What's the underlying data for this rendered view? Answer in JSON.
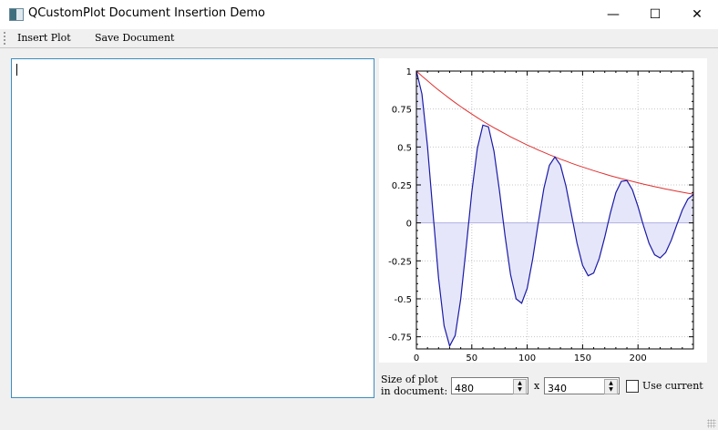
{
  "window": {
    "title": "QCustomPlot Document Insertion Demo",
    "minimize": "—",
    "maximize": "☐",
    "close": "✕"
  },
  "toolbar": {
    "insert_plot": "Insert Plot",
    "save_document": "Save Document"
  },
  "editor": {
    "text": ""
  },
  "controls": {
    "size_label_line1": "Size of plot",
    "size_label_line2": "in document:",
    "width_value": "480",
    "times": "x",
    "height_value": "340",
    "use_current_label": "Use current",
    "use_current_checked": false
  },
  "chart_data": {
    "type": "line",
    "xlim": [
      0,
      250
    ],
    "ylim": [
      -0.83,
      1
    ],
    "x_ticks": [
      0,
      50,
      100,
      150,
      200
    ],
    "y_ticks": [
      1,
      0.75,
      0.5,
      0.25,
      0,
      -0.25,
      -0.5,
      -0.75
    ],
    "x_tick_labels": [
      "0",
      "50",
      "100",
      "150",
      "200"
    ],
    "y_tick_labels": [
      "1",
      "0.75",
      "0.5",
      "0.25",
      "0",
      "-0.25",
      "-0.5",
      "-0.75"
    ],
    "grid": true,
    "x": [
      0,
      5,
      10,
      15,
      20,
      25,
      30,
      35,
      40,
      45,
      50,
      55,
      60,
      65,
      70,
      75,
      80,
      85,
      90,
      95,
      100,
      105,
      110,
      115,
      120,
      125,
      130,
      135,
      140,
      145,
      150,
      155,
      160,
      165,
      170,
      175,
      180,
      185,
      190,
      195,
      200,
      205,
      210,
      215,
      220,
      225,
      230,
      235,
      240,
      245,
      250
    ],
    "series": [
      {
        "color": "#1a1aa6",
        "fill": "#e6e6fb",
        "values": [
          1,
          0.849,
          0.505,
          0.064,
          -0.364,
          -0.678,
          -0.811,
          -0.742,
          -0.501,
          -0.156,
          0.203,
          0.491,
          0.644,
          0.633,
          0.473,
          0.21,
          -0.085,
          -0.342,
          -0.5,
          -0.529,
          -0.431,
          -0.236,
          0.002,
          0.225,
          0.379,
          0.434,
          0.381,
          0.242,
          0.054,
          -0.135,
          -0.28,
          -0.348,
          -0.33,
          -0.234,
          -0.094,
          0.063,
          0.199,
          0.274,
          0.279,
          0.217,
          0.108,
          -0.02,
          -0.135,
          -0.21,
          -0.231,
          -0.195,
          -0.115,
          -0.013,
          0.085,
          0.157,
          0.187
        ]
      },
      {
        "color": "#e03030",
        "values": [
          1,
          0.967,
          0.936,
          0.905,
          0.875,
          0.847,
          0.819,
          0.792,
          0.766,
          0.741,
          0.717,
          0.693,
          0.67,
          0.648,
          0.627,
          0.607,
          0.587,
          0.567,
          0.549,
          0.531,
          0.513,
          0.497,
          0.48,
          0.465,
          0.449,
          0.435,
          0.42,
          0.407,
          0.393,
          0.38,
          0.368,
          0.356,
          0.344,
          0.333,
          0.322,
          0.311,
          0.301,
          0.291,
          0.282,
          0.273,
          0.264,
          0.255,
          0.247,
          0.239,
          0.231,
          0.223,
          0.216,
          0.209,
          0.202,
          0.195,
          0.189
        ]
      }
    ]
  }
}
